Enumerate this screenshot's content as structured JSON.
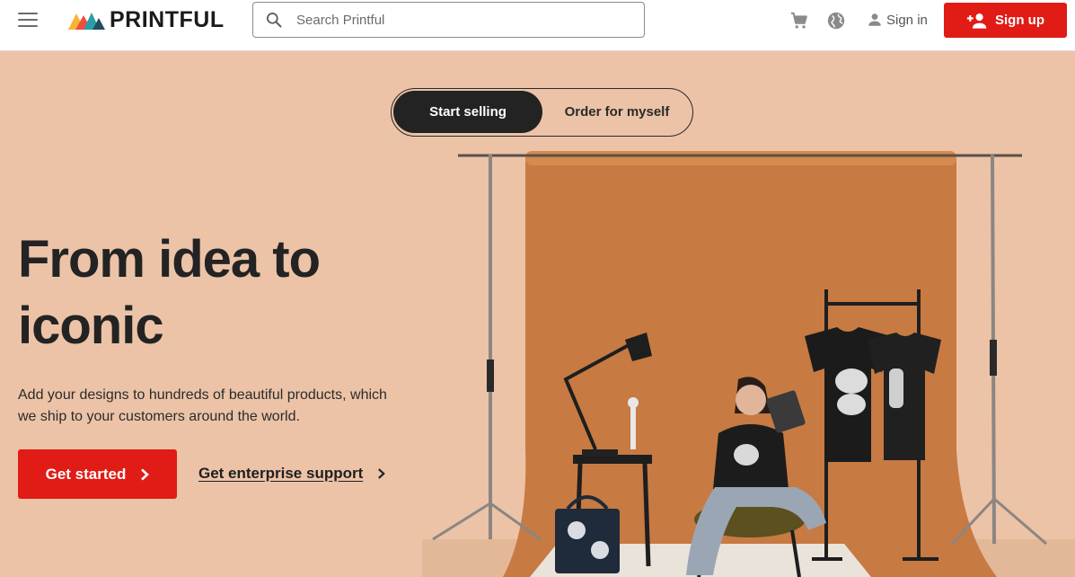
{
  "header": {
    "brand": "PRINTFUL",
    "search_placeholder": "Search Printful",
    "signin_label": "Sign in",
    "signup_label": "Sign up"
  },
  "toggle": {
    "active_label": "Start selling",
    "inactive_label": "Order for myself"
  },
  "hero": {
    "title_line1": "From idea to",
    "title_line2": "iconic",
    "subtitle": "Add your designs to hundreds of beautiful products, which we ship to your customers around the world.",
    "primary_cta": "Get started",
    "secondary_cta": "Get enterprise support"
  },
  "colors": {
    "brand_red": "#e11b15",
    "hero_bg": "#ecc3a7",
    "backdrop": "#c77a42",
    "dark": "#232323"
  },
  "icons": [
    "menu-icon",
    "search-icon",
    "cart-icon",
    "globe-icon",
    "person-icon",
    "person-add-icon",
    "chevron-right-icon"
  ]
}
